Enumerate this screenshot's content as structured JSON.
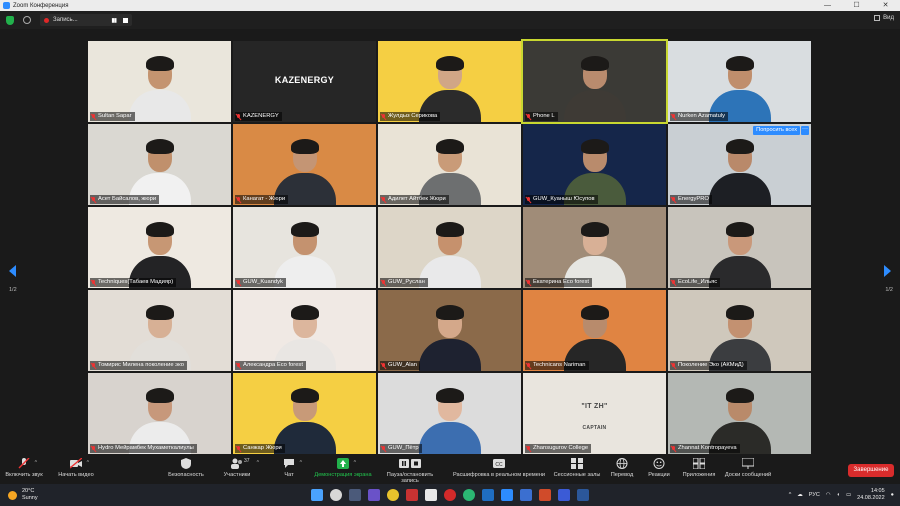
{
  "window": {
    "title": "Zoom Конференция",
    "buttons": [
      "—",
      "☐",
      "✕"
    ]
  },
  "topbar": {
    "recording_label": "Запись...",
    "view_label": "Вид"
  },
  "grid": {
    "page_left": "1/2",
    "page_right": "1/2",
    "tiles": [
      {
        "name": "Sultan Sapar",
        "bg": "#eae6dc",
        "shirt": "#e8e8e8",
        "skin": "#c49470"
      },
      {
        "name": "KAZENERGY",
        "bg": "#262626",
        "text": "KAZENERGY",
        "shirt": "",
        "skin": ""
      },
      {
        "name": "Жулдыз Серикова",
        "bg": "#f5cf43",
        "shirt": "#2b2b2b",
        "skin": "#d1a686"
      },
      {
        "name": "Phone L",
        "bg": "#3b3a36",
        "shirt": "#3e3a35",
        "skin": "#b98b6e"
      },
      {
        "name": "Nurken Azamatuly",
        "bg": "#d9dde0",
        "shirt": "#2d74b8",
        "skin": "#c08e6c"
      },
      {
        "name": "Асет Байсалов, жюри",
        "bg": "#dad8d2",
        "shirt": "#f1f1f1",
        "skin": "#c0906c"
      },
      {
        "name": "Канагат - Жюри",
        "bg": "#d98a45",
        "shirt": "#2c3038",
        "skin": "#c49574"
      },
      {
        "name": "Адилет Айтбек Жюри",
        "bg": "#e9e3d6",
        "shirt": "#6d6f70",
        "skin": "#c99b78"
      },
      {
        "name": "GUW_Куаныш Юсупов",
        "bg": "#15264a",
        "shirt": "#4a5b3c",
        "skin": "#b98b6c"
      },
      {
        "name": "EnergyPRO",
        "bg": "#c9cfd3",
        "shirt": "#1d1f24",
        "skin": "#b9896a",
        "ask": "Попросить всех",
        "more": "···"
      },
      {
        "name": "Techniques(Табаев Мадияр)",
        "bg": "#eee9e1",
        "shirt": "#232325",
        "skin": "#c79774"
      },
      {
        "name": "GUW_Kuandyk",
        "bg": "#e7e4de",
        "shirt": "#eeeeee",
        "skin": "#c4926f"
      },
      {
        "name": "GUW_Руслан",
        "bg": "#ddd6c8",
        "shirt": "#e9e9ea",
        "skin": "#c6916d"
      },
      {
        "name": "Екатерина Eco forest",
        "bg": "#a08c78",
        "shirt": "#e6e6e2",
        "skin": "#d8b096"
      },
      {
        "name": "EcoLife_Ильяс",
        "bg": "#c8c4bc",
        "shirt": "#2a2a2c",
        "skin": "#c9987a"
      },
      {
        "name": "Томирис Милена поколение эко",
        "bg": "#e3ddd6",
        "shirt": "#e2dfda",
        "skin": "#d7b095"
      },
      {
        "name": "Александра Eco forest",
        "bg": "#f0e9e4",
        "shirt": "#e9e6e3",
        "skin": "#dcb69d"
      },
      {
        "name": "GUW_Alan",
        "bg": "#8b6a4a",
        "shirt": "#1e2230",
        "skin": "#d4a88a"
      },
      {
        "name": "Technicans Nariman",
        "bg": "#e08442",
        "shirt": "#262626",
        "skin": "#b88b6c"
      },
      {
        "name": "Поколение Эко (АКМиД)",
        "bg": "#cfc8bc",
        "shirt": "#3b3d40",
        "skin": "#c39171"
      },
      {
        "name": "Hydro Мейрамбек Мухаметкалиулы",
        "bg": "#d8d3ce",
        "shirt": "#ececec",
        "skin": "#c7987b"
      },
      {
        "name": "Санжар Жюри",
        "bg": "#f5cf43",
        "shirt": "#1f2a3a",
        "skin": "#c89a78"
      },
      {
        "name": "GUW_Пётр",
        "bg": "#dcdcdc",
        "shirt": "#3c6eb0",
        "skin": "#e1b89f"
      },
      {
        "name": "Zhansugurov College",
        "bg": "#e9e5de",
        "text": "\"IT ZH\"",
        "sub": "CAPTAIN",
        "shirt": "",
        "skin": ""
      },
      {
        "name": "Zhannat Kontropayeva",
        "bg": "#b4b8b4",
        "shirt": "#2b2b28",
        "skin": "#b98a6a"
      }
    ]
  },
  "toolbar": {
    "unmute_label": "Включить звук",
    "video_label": "Начать видео",
    "security_label": "Безопасность",
    "participants_label": "Участники",
    "participants_count": "37",
    "chat_label": "Чат",
    "share_label": "Демонстрация экрана",
    "pause_label": "Пауза/остановить запись",
    "cc_label": "Расшифровка в реальном времени",
    "rooms_label": "Сессионные залы",
    "translate_label": "Перевод",
    "reactions_label": "Реакции",
    "apps_label": "Приложения",
    "whiteboard_label": "Доски сообщений",
    "end_label": "Завершение"
  },
  "taskbar": {
    "temp": "20°C",
    "weather": "Sunny",
    "lang": "РУС",
    "time": "14:05",
    "date": "24.08.2022"
  },
  "colors": {
    "active_speaker": "#c8d730",
    "share_green": "#22b14c",
    "end_red": "#d92c2c",
    "accent_blue": "#2d8cff"
  }
}
